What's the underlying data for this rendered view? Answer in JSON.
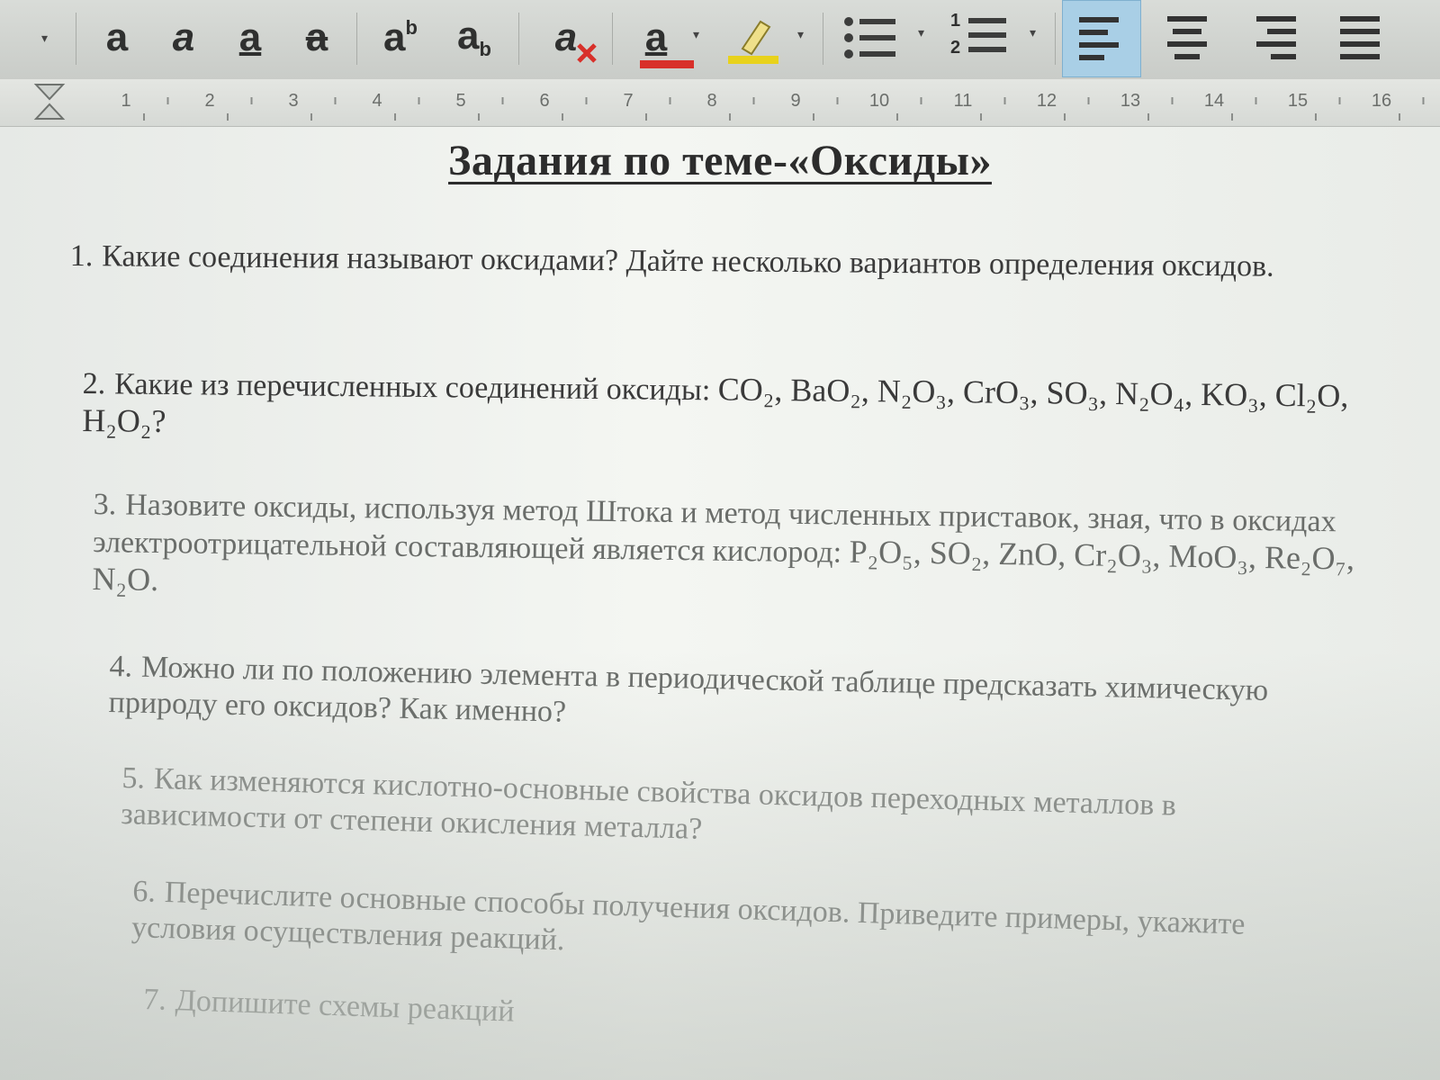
{
  "toolbar": {
    "icons": [
      {
        "name": "bold-icon",
        "glyph": "a"
      },
      {
        "name": "italic-icon",
        "glyph": "a"
      },
      {
        "name": "underline-icon",
        "glyph": "a"
      },
      {
        "name": "strikethrough-icon",
        "glyph": "a"
      },
      {
        "name": "superscript-icon",
        "glyph": "a",
        "mark": "b"
      },
      {
        "name": "subscript-icon",
        "glyph": "a",
        "mark": "b"
      },
      {
        "name": "clear-formatting-icon",
        "glyph": "a"
      },
      {
        "name": "font-color-icon",
        "glyph": "a"
      },
      {
        "name": "highlight-icon"
      },
      {
        "name": "bullet-list-icon"
      },
      {
        "name": "numbered-list-icon",
        "marks": [
          "1",
          "2"
        ]
      },
      {
        "name": "align-left-icon"
      },
      {
        "name": "align-center-icon"
      },
      {
        "name": "align-right-icon"
      },
      {
        "name": "justify-icon"
      }
    ],
    "colors": {
      "font_color": "#d8302a",
      "highlight": "#e8d21c",
      "active_bg": "#a9cfe6"
    }
  },
  "ruler": {
    "numbers": [
      "1",
      "2",
      "3",
      "4",
      "5",
      "6",
      "7",
      "8",
      "9",
      "10",
      "11",
      "12",
      "13",
      "14",
      "15",
      "16"
    ]
  },
  "document": {
    "title": "Задания по теме-«Оксиды»",
    "questions": [
      {
        "num": "1.",
        "text": "Какие соединения называют оксидами? Дайте несколько вариантов определения оксидов."
      },
      {
        "num": "2.",
        "text": "Какие из перечисленных соединений оксиды:",
        "formulas": [
          "CO₂",
          "BaO₂",
          "N₂O₃",
          "CrO₃",
          "SO₃",
          "N₂O₄",
          "KO₃",
          "Cl₂O",
          "H₂O₂?"
        ]
      },
      {
        "num": "3.",
        "text": "Назовите оксиды, используя метод Штока и метод численных приставок, зная, что в оксидах электроотрицательной составляющей является кислород:",
        "formulas": [
          "P₂O₅",
          "SO₂",
          "ZnO",
          "Cr₂O₃",
          "MoO₃",
          "Re₂O₇",
          "N₂O."
        ]
      },
      {
        "num": "4.",
        "text": "Можно ли по положению элемента в периодической таблице предсказать химическую природу его оксидов? Как именно?"
      },
      {
        "num": "5.",
        "text": "Как изменяются кислотно-основные свойства оксидов переходных металлов в зависимости от степени окисления металла?"
      },
      {
        "num": "6.",
        "text": "Перечислите основные способы получения оксидов. Приведите примеры, укажите условия осуществления реакций."
      },
      {
        "num": "7.",
        "text": "Допишите схемы реакций"
      }
    ]
  }
}
